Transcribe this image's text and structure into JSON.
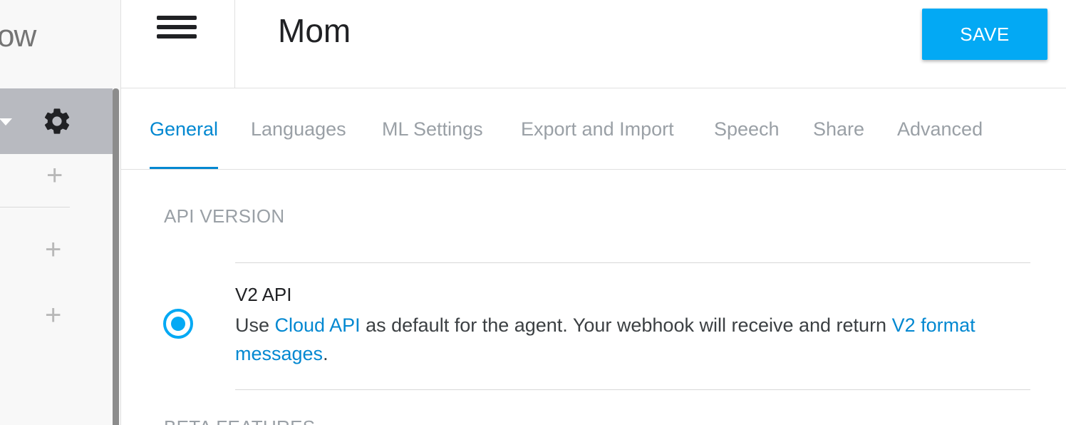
{
  "sidebar": {
    "brand_fragment": "ow",
    "agent_dropdown_icon": "caret-down-icon",
    "settings_icon": "gear-icon",
    "add_icon": "+",
    "add_buttons": [
      "+",
      "+",
      "+"
    ]
  },
  "header": {
    "menu_icon": "hamburger-menu-icon",
    "agent_name": "Mom",
    "save_label": "SAVE"
  },
  "tabs": [
    {
      "label": "General",
      "active": true
    },
    {
      "label": "Languages",
      "active": false
    },
    {
      "label": "ML Settings",
      "active": false
    },
    {
      "label": "Export and Import",
      "active": false
    },
    {
      "label": "Speech",
      "active": false
    },
    {
      "label": "Share",
      "active": false
    },
    {
      "label": "Advanced",
      "active": false
    }
  ],
  "content": {
    "api_version_title": "API VERSION",
    "option": {
      "title": "V2 API",
      "selected": true,
      "desc_before": "Use ",
      "link1": "Cloud API",
      "desc_middle": " as default for the agent. Your webhook will receive and return ",
      "link2": "V2 format messages",
      "desc_after": "."
    },
    "beta_title": "BETA FEATURES"
  },
  "colors": {
    "accent": "#03a9f4",
    "link": "#0288d1",
    "muted": "#9aa0a6",
    "sidebar_agent_bar": "#b8bac0"
  }
}
